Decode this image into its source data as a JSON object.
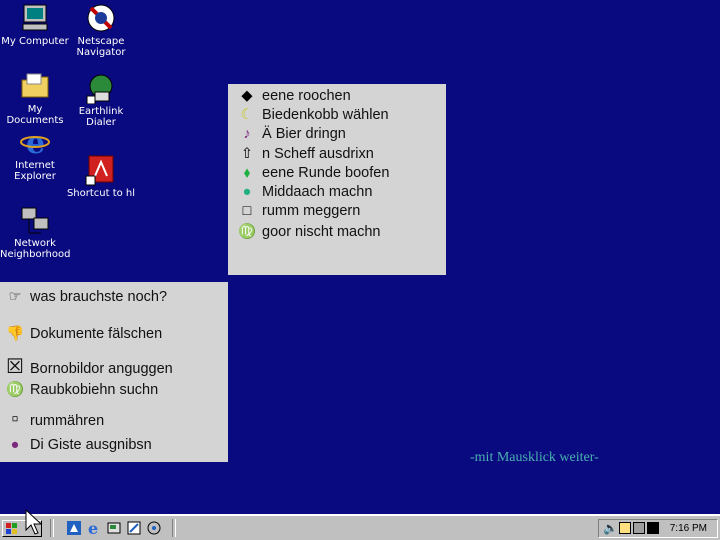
{
  "desktop": {
    "icons": [
      {
        "label_lines": [
          "My Computer"
        ]
      },
      {
        "label_lines": [
          "Netscape",
          "Navigator"
        ]
      },
      {
        "label_lines": [
          "My Documents"
        ]
      },
      {
        "label_lines": [
          "Earthlink",
          "Dialer"
        ]
      },
      {
        "label_lines": [
          "Internet",
          "Explorer"
        ]
      },
      {
        "label_lines": [
          "Shortcut to hl"
        ]
      },
      {
        "label_lines": [
          "Network",
          "Neighborhood"
        ]
      }
    ]
  },
  "right_panel": {
    "items": [
      {
        "symbol": "◆",
        "text": "eene roochen",
        "symbol_color": "#000000"
      },
      {
        "symbol": "☾",
        "text": "Biedenkobb wählen",
        "symbol_color": "#c8c820"
      },
      {
        "symbol": "♪",
        "text": "Ä Bier dringn",
        "symbol_color": "#7d2a7d"
      },
      {
        "symbol": "⇧",
        "text": "n Scheff ausdrixn",
        "symbol_color": "#000000"
      },
      {
        "symbol": "⬧",
        "text": "eene Runde boofen",
        "symbol_color": "#20b040"
      },
      {
        "symbol": "●",
        "text": "Middaach machn",
        "symbol_color": "#20b080"
      },
      {
        "symbol": "□",
        "text": "rumm meggern",
        "symbol_color": "#000000"
      },
      {
        "symbol": "♍",
        "text": "goor nischt machn",
        "symbol_color": "#d02020"
      }
    ]
  },
  "left_panel": {
    "items": [
      {
        "symbol": "☞",
        "text": "was brauchste noch?",
        "symbol_color": "#000000"
      },
      {
        "symbol": "👎",
        "text": "Dokumente fälschen",
        "symbol_color": "#000000"
      },
      {
        "symbol": "☒",
        "text": "Bornobildor anguggen",
        "symbol_color": "#000000"
      },
      {
        "symbol": "♍",
        "text": "Raubkobiehn suchn",
        "symbol_color": "#c8c020"
      },
      {
        "symbol": "▫",
        "text": "rummähren",
        "symbol_color": "#000000"
      },
      {
        "symbol": "●",
        "text": "Di Giste ausgnibsn",
        "symbol_color": "#7d2a7d"
      }
    ]
  },
  "notice": "-mit Mausklick weiter-",
  "taskbar": {
    "clock": "7:16 PM"
  }
}
